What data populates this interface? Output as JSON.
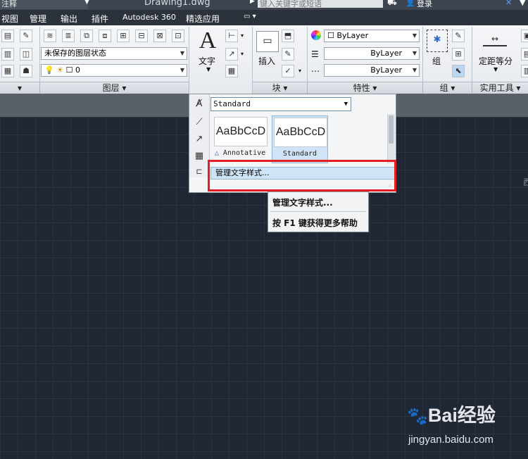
{
  "titlebar": {
    "workspace": "注释",
    "document": "Drawing1.dwg",
    "search_placeholder": "键入关键字或短语",
    "login": "登录"
  },
  "menubar": {
    "items": [
      "视图",
      "管理",
      "输出",
      "插件",
      "Autodesk 360",
      "精选应用"
    ]
  },
  "ribbon": {
    "layer_state": "未保存的图层状态",
    "layer_current": "0",
    "text_label": "文字",
    "insert_label": "插入",
    "group_label": "组",
    "measure_label": "定距等分",
    "bylayer": [
      "ByLayer",
      "ByLayer",
      "ByLayer"
    ],
    "panels": {
      "layers": "图层",
      "block": "块",
      "properties": "特性",
      "groups": "组",
      "utilities": "实用工具"
    }
  },
  "text_style_dropdown": {
    "current": "Standard",
    "gallery": [
      {
        "preview": "AaBbCcD",
        "caption": "Annotative"
      },
      {
        "preview": "AaBbCcD",
        "caption": "Standard"
      }
    ],
    "manage": "管理文字样式..."
  },
  "context_menu": {
    "items": [
      "管理文字样式...",
      "按 F1 键获得更多帮助"
    ]
  },
  "watermark": {
    "brand": "Bai经验",
    "url": "jingyan.baidu.com"
  },
  "colors": {
    "highlight": "#e31e24",
    "canvas": "#1f2735"
  }
}
